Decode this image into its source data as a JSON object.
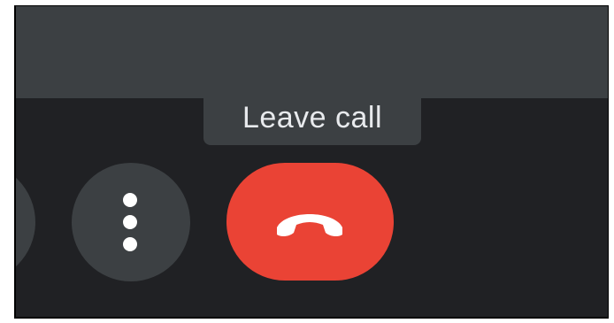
{
  "tooltip": {
    "text": "Leave call"
  },
  "buttons": {
    "more_options_icon": "more-vert-icon",
    "leave_call_icon": "call-end-icon"
  },
  "colors": {
    "top_band": "#3c4043",
    "controls_background": "#202124",
    "round_button": "#3c4043",
    "leave_button": "#ea4335",
    "icon": "#ffffff",
    "tooltip_text": "#e8eaed"
  }
}
